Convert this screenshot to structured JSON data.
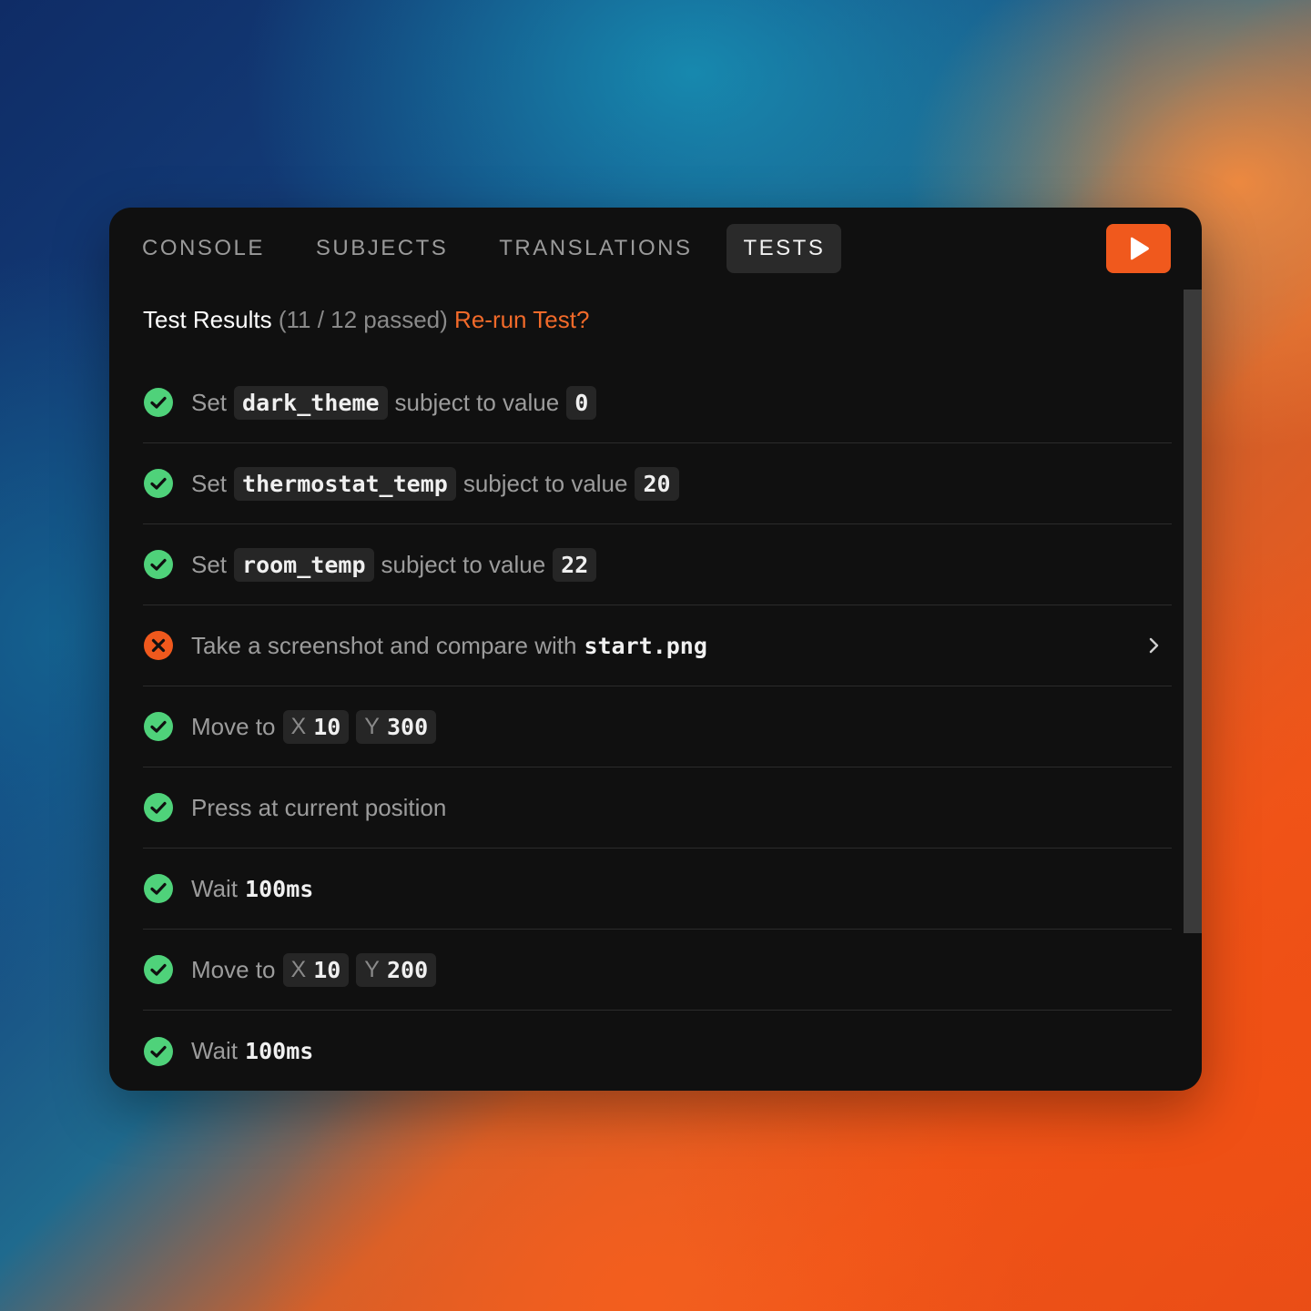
{
  "tabs": [
    {
      "label": "CONSOLE",
      "active": false
    },
    {
      "label": "SUBJECTS",
      "active": false
    },
    {
      "label": "TRANSLATIONS",
      "active": false
    },
    {
      "label": "TESTS",
      "active": true
    }
  ],
  "run_button": {
    "icon": "play-icon",
    "color": "#f0591d"
  },
  "summary": {
    "title": "Test Results",
    "count": "(11 / 12 passed)",
    "rerun": "Re-run Test?"
  },
  "tests": [
    {
      "status": "pass",
      "parts": [
        "Set",
        "dark_theme",
        "subject to value",
        "0"
      ]
    },
    {
      "status": "pass",
      "parts": [
        "Set",
        "thermostat_temp",
        "subject to value",
        "20"
      ]
    },
    {
      "status": "pass",
      "parts": [
        "Set",
        "room_temp",
        "subject to value",
        "22"
      ]
    },
    {
      "status": "fail",
      "parts": [
        "Take a screenshot and compare with",
        "start.png"
      ]
    },
    {
      "status": "pass",
      "parts": [
        "Move to",
        "X",
        "10",
        "Y",
        "300"
      ]
    },
    {
      "status": "pass",
      "parts": [
        "Press at current position"
      ]
    },
    {
      "status": "pass",
      "parts": [
        "Wait",
        "100ms"
      ]
    },
    {
      "status": "pass",
      "parts": [
        "Move to",
        "X",
        "10",
        "Y",
        "200"
      ]
    },
    {
      "status": "pass",
      "parts": [
        "Wait",
        "100ms"
      ]
    }
  ],
  "colors": {
    "pass": "#4fd27a",
    "fail": "#f0591d",
    "accent": "#f26a2a"
  }
}
